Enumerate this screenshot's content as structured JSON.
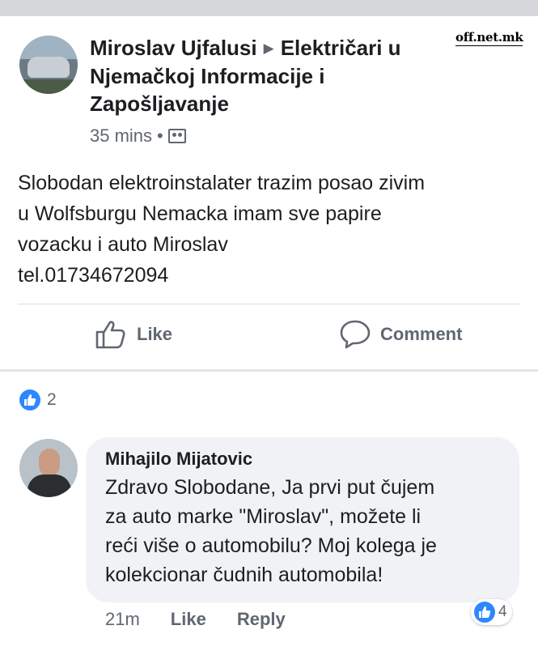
{
  "watermark": "off.net.mk",
  "post": {
    "author": "Miroslav Ujfalusi",
    "group": "Električari u Njemačkoj Informacije i Zapošljavanje",
    "time": "35 mins",
    "privacy_icon": "group-members-icon",
    "text": "Slobodan elektroinstalater trazim posao zivim\nu Wolfsburgu Nemacka imam sve papire\nvozacku i auto Miroslav\ntel.01734672094",
    "actions": {
      "like": "Like",
      "comment": "Comment"
    },
    "reactions": "2"
  },
  "comment": {
    "author": "Mihajilo Mijatovic",
    "text": "Zdravo Slobodane, Ja prvi put čujem\nza auto marke \"Miroslav\", možete li\nreći više o automobilu? Moj kolega je\nkolekcionar čudnih automobila!",
    "time": "21m",
    "like": "Like",
    "reply": "Reply",
    "reactions": "4"
  },
  "colors": {
    "like_blue": "#2d88ff",
    "secondary_text": "#606770",
    "bubble": "#f0f2f5"
  }
}
